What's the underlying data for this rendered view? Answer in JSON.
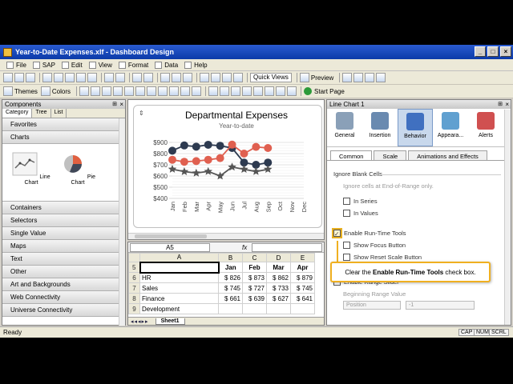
{
  "window": {
    "title": "Year-to-Date Expenses.xlf - Dashboard Design"
  },
  "menu": [
    "File",
    "SAP",
    "Edit",
    "View",
    "Format",
    "Data",
    "Help"
  ],
  "toolbar": {
    "themes": "Themes",
    "colors": "Colors",
    "quick_views": "Quick Views",
    "preview": "Preview",
    "start_page": "Start Page"
  },
  "components": {
    "title": "Components",
    "tabs": [
      "Category",
      "Tree",
      "List"
    ],
    "categories_top": [
      "Favorites",
      "Charts"
    ],
    "chart_items": [
      "Line Chart",
      "Pie Chart"
    ],
    "categories": [
      "Containers",
      "Selectors",
      "Single Value",
      "Maps",
      "Text",
      "Other",
      "Art and Backgrounds",
      "Web Connectivity",
      "Universe Connectivity"
    ]
  },
  "chart_data": {
    "type": "line",
    "title": "Departmental Expenses",
    "subtitle": "Year-to-date",
    "categories": [
      "Jan",
      "Feb",
      "Mar",
      "Apr",
      "May",
      "Jun",
      "Jul",
      "Aug",
      "Sep",
      "Oct",
      "Nov",
      "Dec"
    ],
    "ylim": [
      400,
      900
    ],
    "yticks": [
      "$900",
      "$800",
      "$700",
      "$600",
      "$500",
      "$400"
    ],
    "series": [
      {
        "color": "#2d3a50",
        "marker": "circle",
        "values": [
          826,
          873,
          862,
          879,
          870,
          850,
          720,
          700,
          720
        ]
      },
      {
        "color": "#e06050",
        "marker": "circle",
        "values": [
          745,
          727,
          733,
          745,
          760,
          880,
          800,
          860,
          850
        ]
      },
      {
        "color": "#555555",
        "marker": "star",
        "values": [
          661,
          639,
          627,
          641,
          600,
          680,
          660,
          640,
          660
        ]
      }
    ]
  },
  "sheet": {
    "namebox": "A5",
    "fx": "fx",
    "cols": [
      "A",
      "B",
      "C",
      "D",
      "E"
    ],
    "rows": [
      {
        "n": "5",
        "cells": [
          "",
          "Jan",
          "Feb",
          "Mar",
          "Apr"
        ]
      },
      {
        "n": "6",
        "cells": [
          "HR",
          "$ 826",
          "$ 873",
          "$ 862",
          "$ 879"
        ]
      },
      {
        "n": "7",
        "cells": [
          "Sales",
          "$ 745",
          "$ 727",
          "$ 733",
          "$ 745"
        ]
      },
      {
        "n": "8",
        "cells": [
          "Finance",
          "$ 661",
          "$ 639",
          "$ 627",
          "$ 641"
        ]
      },
      {
        "n": "9",
        "cells": [
          "Development",
          "",
          "",
          "",
          ""
        ]
      }
    ],
    "tab": "Sheet1"
  },
  "properties": {
    "title": "Line Chart 1",
    "icons": [
      "General",
      "Insertion",
      "Behavior",
      "Appeara...",
      "Alerts"
    ],
    "subtabs": [
      "Common",
      "Scale",
      "Animations and Effects"
    ],
    "ignore_blank": "Ignore Blank Cells",
    "ignore_end": "Ignore cells at End-of-Range only.",
    "in_series": "In Series",
    "in_values": "In Values",
    "enable_rt": "Enable Run-Time Tools",
    "show_focus": "Show Focus Button",
    "show_reset": "Show Reset Scale Button",
    "enable_range": "Enable Range Slider",
    "begin_range": "Beginning Range Value",
    "position": "Position",
    "minus_one": "-1"
  },
  "callout": {
    "pre": "Clear the ",
    "bold": "Enable Run-Time Tools",
    "post": " check box."
  },
  "status": {
    "left": "Ready",
    "cap": "CAP",
    "num": "NUM",
    "scrl": "SCRL"
  }
}
